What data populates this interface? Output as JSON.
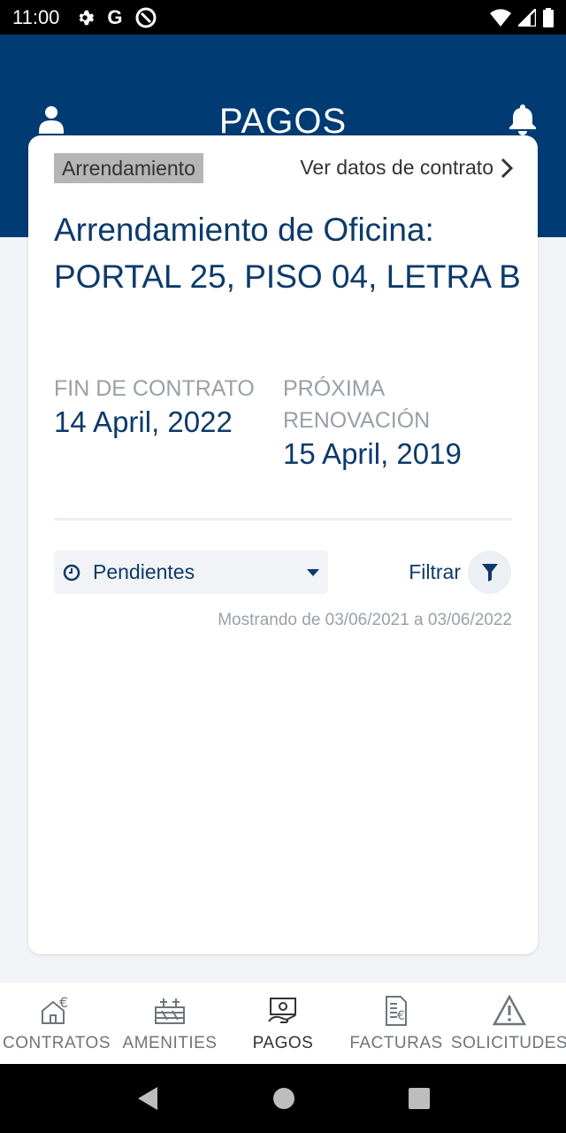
{
  "status_bar": {
    "time": "11:00",
    "left_icons": [
      "settings-icon",
      "google-g-icon",
      "at-sign-icon"
    ],
    "right_icons": [
      "wifi-icon",
      "signal-icon",
      "battery-icon"
    ]
  },
  "header": {
    "title": "PAGOS",
    "left_icon": "user-icon",
    "right_icon": "bell-icon",
    "color": "#003b73"
  },
  "card": {
    "tag": "Arrendamiento",
    "contract_link": "Ver datos de contrato",
    "title": "Arrendamiento de Oficina: PORTAL 25, PISO 04, LETRA B",
    "end_label": "FIN DE CONTRATO",
    "end_value": "14 April, 2022",
    "renewal_label": "PRÓXIMA RENOVACIÓN",
    "renewal_value": "15 April, 2019",
    "dropdown_value": "Pendientes",
    "filter_label": "Filtrar",
    "range_text": "Mostrando de 03/06/2021 a 03/06/2022"
  },
  "bottom_nav": {
    "items": [
      {
        "label": "CONTRATOS",
        "icon": "contract-house-euro-icon",
        "active": false
      },
      {
        "label": "AMENITIES",
        "icon": "amenities-icon",
        "active": false
      },
      {
        "label": "PAGOS",
        "icon": "payments-icon",
        "active": true
      },
      {
        "label": "FACTURAS",
        "icon": "invoice-euro-icon",
        "active": false
      },
      {
        "label": "SOLICITUDES",
        "icon": "warning-icon",
        "active": false
      }
    ]
  },
  "system_nav": [
    "back-icon",
    "home-icon",
    "recents-icon"
  ],
  "colors": {
    "primary": "#003b73",
    "text_dark_blue": "#0d3a6b",
    "muted": "#9aa0a6",
    "background": "#f1f3f6"
  }
}
